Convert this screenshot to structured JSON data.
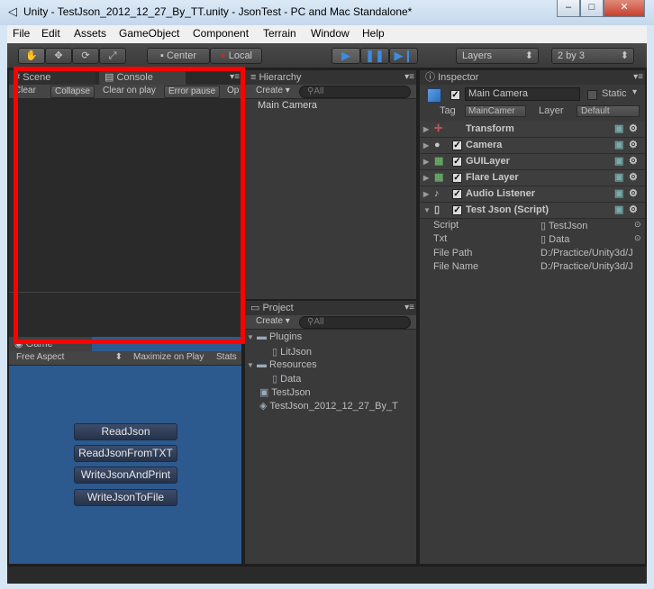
{
  "window": {
    "title": "Unity - TestJson_2012_12_27_By_TT.unity - JsonTest - PC and Mac Standalone*",
    "min": "–",
    "max": "□",
    "close": "✕"
  },
  "menu": [
    "File",
    "Edit",
    "Assets",
    "GameObject",
    "Component",
    "Terrain",
    "Window",
    "Help"
  ],
  "toolbar": {
    "center": "Center",
    "local": "Local",
    "layers": "Layers",
    "layout": "2 by 3"
  },
  "scene": {
    "tab_scene": "Scene",
    "tab_console": "Console",
    "buttons": [
      "Clear",
      "Collapse",
      "Clear on play",
      "Error pause",
      "Op"
    ]
  },
  "game": {
    "tab": "Game",
    "aspect": "Free Aspect",
    "maximize": "Maximize on Play",
    "stats": "Stats",
    "buttons": [
      "ReadJson",
      "ReadJsonFromTXT",
      "WriteJsonAndPrint",
      "WriteJsonToFile"
    ]
  },
  "hierarchy": {
    "tab": "Hierarchy",
    "create": "Create",
    "search": "All",
    "items": [
      "Main Camera"
    ]
  },
  "project": {
    "tab": "Project",
    "create": "Create",
    "search": "All",
    "items": [
      "Plugins",
      "LitJson",
      "Resources",
      "Data",
      "TestJson",
      "TestJson_2012_12_27_By_T"
    ]
  },
  "inspector": {
    "tab": "Inspector",
    "object_name": "Main Camera",
    "static": "Static",
    "tag_label": "Tag",
    "tag_value": "MainCamer",
    "layer_label": "Layer",
    "layer_value": "Default",
    "components": [
      "Transform",
      "Camera",
      "GUILayer",
      "Flare Layer",
      "Audio Listener",
      "Test Json (Script)"
    ],
    "fields": [
      {
        "label": "Script",
        "value": "TestJson"
      },
      {
        "label": "Txt",
        "value": "Data"
      },
      {
        "label": "File Path",
        "value": "D:/Practice/Unity3d/J"
      },
      {
        "label": "File Name",
        "value": "D:/Practice/Unity3d/J"
      }
    ]
  },
  "colors": {
    "highlight": "#ff0000",
    "accent": "#3d8ce0"
  }
}
